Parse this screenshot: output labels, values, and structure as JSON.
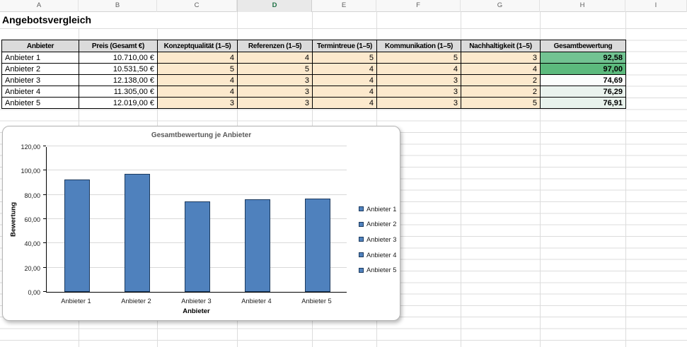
{
  "sheet": {
    "column_letters": [
      "A",
      "B",
      "C",
      "D",
      "E",
      "F",
      "G",
      "H",
      "I"
    ],
    "selected_column": "D",
    "title": "Angebotsvergleich"
  },
  "table": {
    "headers": [
      "Anbieter",
      "Preis (Gesamt €)",
      "Konzeptqualität (1–5)",
      "Referenzen (1–5)",
      "Termintreue (1–5)",
      "Kommunikation (1–5)",
      "Nachhaltigkeit (1–5)",
      "Gesamtbewertung"
    ],
    "score_bg": "#fce9cd",
    "header_bg": "#dbdbdb",
    "rows": [
      {
        "anbieter": "Anbieter 1",
        "preis": "10.710,00 €",
        "scores": [
          "4",
          "4",
          "5",
          "5",
          "3"
        ],
        "gesamt": "92,58",
        "gesamt_bg": "#72c392"
      },
      {
        "anbieter": "Anbieter 2",
        "preis": "10.531,50 €",
        "scores": [
          "5",
          "5",
          "4",
          "4",
          "4"
        ],
        "gesamt": "97,00",
        "gesamt_bg": "#5cba7d"
      },
      {
        "anbieter": "Anbieter 3",
        "preis": "12.138,00 €",
        "scores": [
          "4",
          "3",
          "4",
          "3",
          "2"
        ],
        "gesamt": "74,69",
        "gesamt_bg": "#fbfdfc"
      },
      {
        "anbieter": "Anbieter 4",
        "preis": "11.305,00 €",
        "scores": [
          "4",
          "3",
          "4",
          "3",
          "2"
        ],
        "gesamt": "76,29",
        "gesamt_bg": "#eaf3ee"
      },
      {
        "anbieter": "Anbieter 5",
        "preis": "12.019,00 €",
        "scores": [
          "3",
          "3",
          "4",
          "3",
          "5"
        ],
        "gesamt": "76,91",
        "gesamt_bg": "#e8f2ec"
      }
    ]
  },
  "chart_data": {
    "type": "bar",
    "title": "Gesamtbewertung je Anbieter",
    "xlabel": "Anbieter",
    "ylabel": "Bewertung",
    "categories": [
      "Anbieter 1",
      "Anbieter 2",
      "Anbieter 3",
      "Anbieter 4",
      "Anbieter 5"
    ],
    "values": [
      92.58,
      97.0,
      74.69,
      76.29,
      76.91
    ],
    "ylim": [
      0,
      120
    ],
    "ytick_step": 20,
    "ytick_labels": [
      "0,00",
      "20,00",
      "40,00",
      "60,00",
      "80,00",
      "100,00",
      "120,00"
    ],
    "legend": [
      "Anbieter 1",
      "Anbieter 2",
      "Anbieter 3",
      "Anbieter 4",
      "Anbieter 5"
    ],
    "legend_position": "right",
    "grid": true,
    "bar_color": "#4f81bd",
    "bar_border": "#1c3a5e"
  }
}
